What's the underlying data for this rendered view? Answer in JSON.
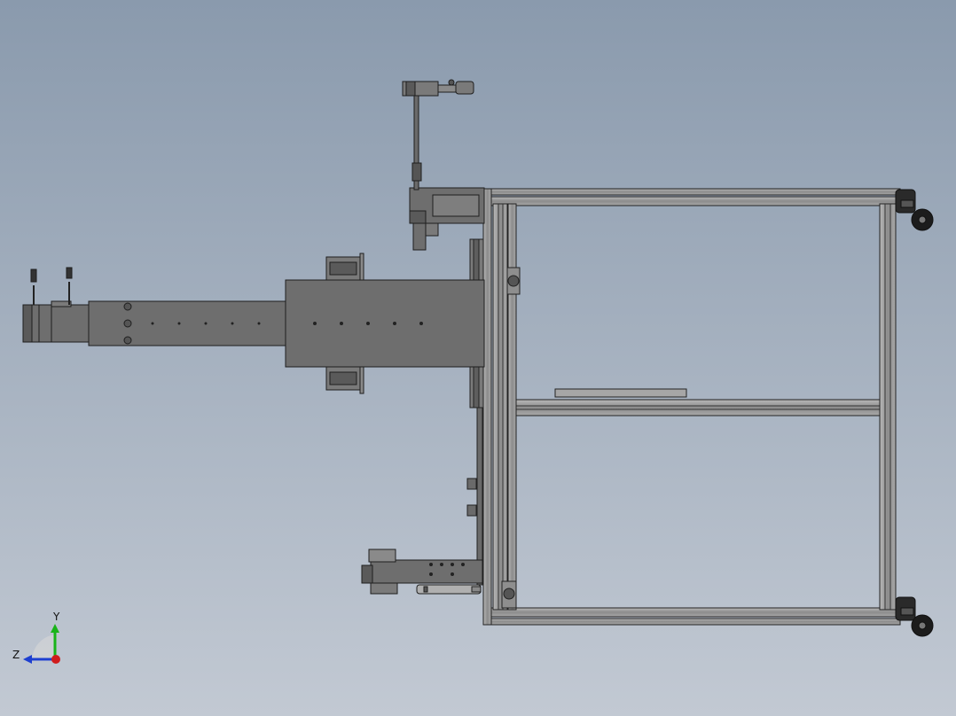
{
  "viewport": {
    "background_top": "#8a9aad",
    "background_bottom": "#c2c9d3",
    "part_color": "#6e6e6e",
    "edge_color": "#1e1e1e",
    "frame_color": "#9a9a9a"
  },
  "triad": {
    "y_label": "Y",
    "z_label": "Z",
    "y_color": "#19b319",
    "z_color": "#1d3fd0",
    "x_color": "#d01c1c"
  }
}
